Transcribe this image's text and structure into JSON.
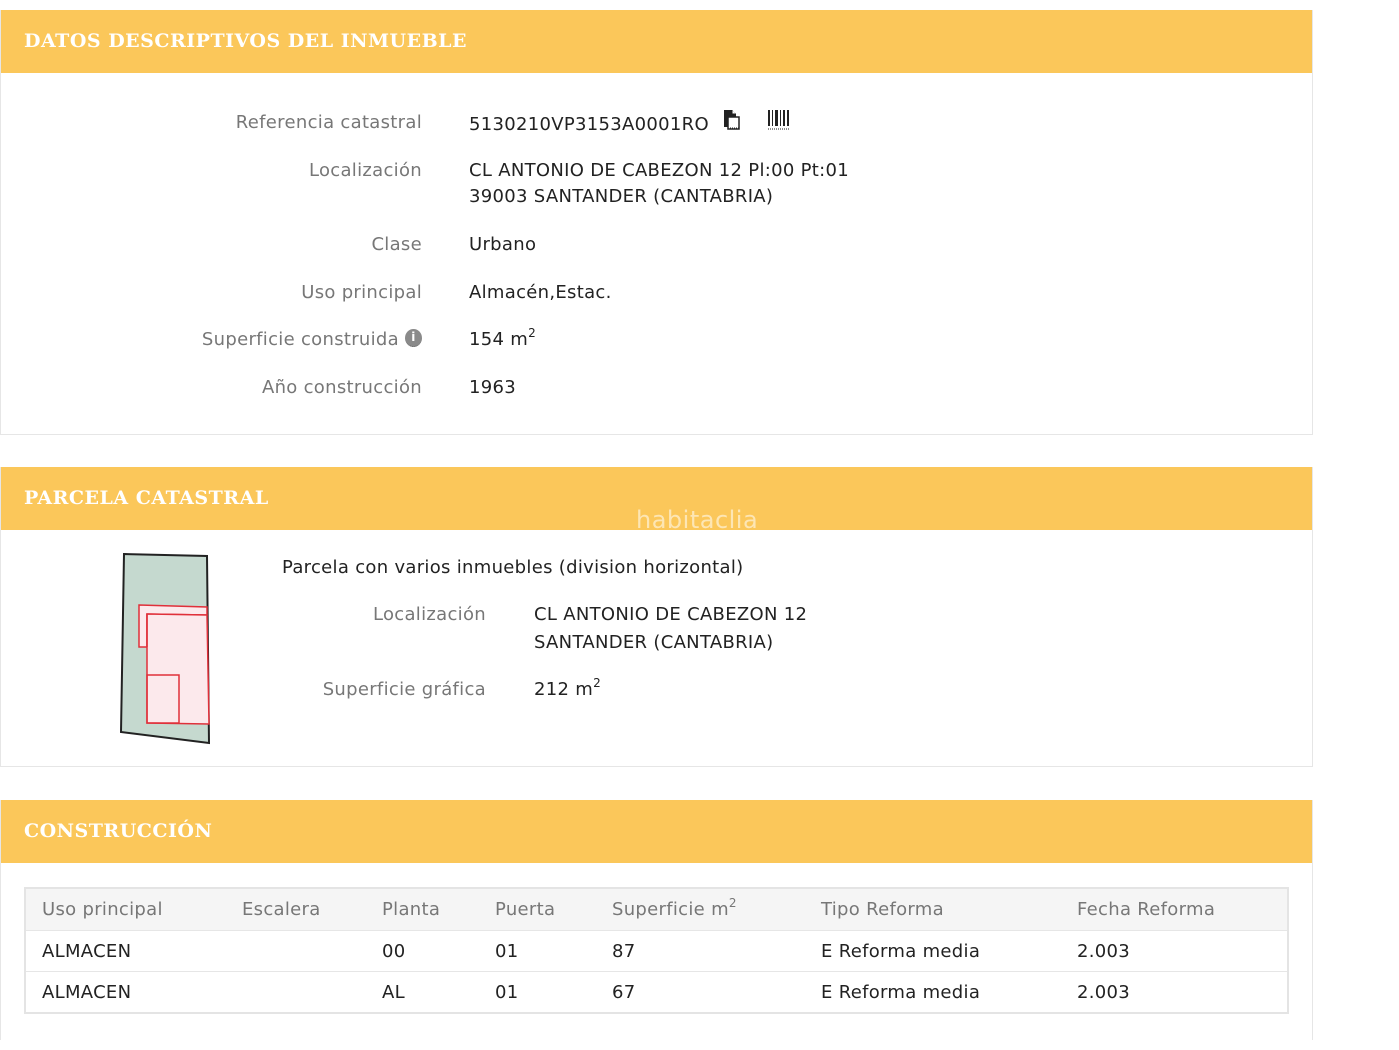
{
  "datos": {
    "header": "DATOS DESCRIPTIVOS DEL INMUEBLE",
    "referencia_label": "Referencia catastral",
    "referencia_value": "5130210VP3153A0001RO",
    "localizacion_label": "Localización",
    "localizacion_line1": "CL ANTONIO DE CABEZON 12 Pl:00 Pt:01",
    "localizacion_line2": "39003 SANTANDER (CANTABRIA)",
    "clase_label": "Clase",
    "clase_value": "Urbano",
    "uso_label": "Uso principal",
    "uso_value": "Almacén,Estac.",
    "superficie_label": "Superficie construida",
    "superficie_value": "154 m",
    "superficie_unit_sup": "2",
    "anio_label": "Año construcción",
    "anio_value": "1963"
  },
  "parcela": {
    "header": "PARCELA CATASTRAL",
    "description": "Parcela con varios inmuebles (division horizontal)",
    "localizacion_label": "Localización",
    "localizacion_line1": "CL ANTONIO DE CABEZON 12",
    "localizacion_line2": "SANTANDER (CANTABRIA)",
    "superficie_label": "Superficie gráfica",
    "superficie_value": "212 m",
    "superficie_unit_sup": "2"
  },
  "construccion": {
    "header": "CONSTRUCCIÓN",
    "columns": [
      "Uso principal",
      "Escalera",
      "Planta",
      "Puerta",
      "Superficie m",
      "Tipo Reforma",
      "Fecha Reforma"
    ],
    "superficie_col_sup": "2",
    "rows": [
      [
        "ALMACEN",
        "",
        "00",
        "01",
        "87",
        "E Reforma media",
        "2.003"
      ],
      [
        "ALMACEN",
        "",
        "AL",
        "01",
        "67",
        "E Reforma media",
        "2.003"
      ]
    ]
  },
  "watermark": "habitaclia",
  "colors": {
    "header_bg": "#fbc75a",
    "header_text": "#ffffff",
    "parcel_fill": "#c5d9cf",
    "building_outline": "#e0303a",
    "building_fill": "#fce9ec"
  },
  "icons": [
    "copy-icon",
    "barcode-icon",
    "info-icon"
  ]
}
